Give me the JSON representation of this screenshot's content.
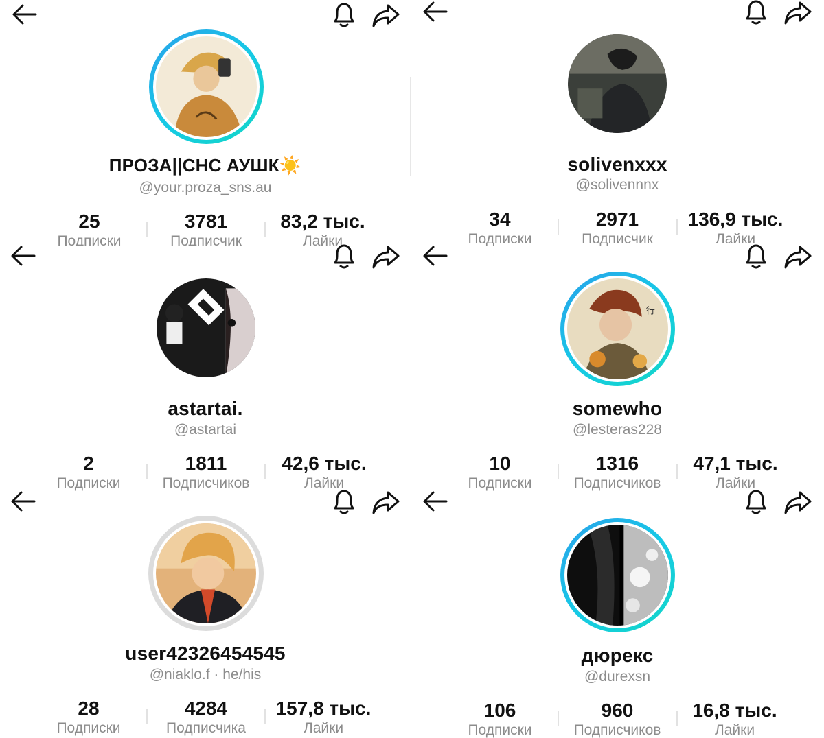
{
  "profiles": [
    {
      "display_name": "ПРОЗА||СНС АУШК☀️",
      "handle": "@your.proza_sns.au",
      "stats": [
        {
          "value": "25",
          "label": "Подписки"
        },
        {
          "value": "3781",
          "label": "Подписчик"
        },
        {
          "value": "83,2 тыс.",
          "label": "Лайки"
        }
      ],
      "ring": "gradient",
      "icons": {
        "back": "arrow-left-icon",
        "notify": "bell-icon",
        "share": "share-arrow-icon"
      }
    },
    {
      "display_name": "solivenxxx",
      "handle": "@solivennnx",
      "stats": [
        {
          "value": "34",
          "label": "Подписки"
        },
        {
          "value": "2971",
          "label": "Подписчик"
        },
        {
          "value": "136,9 тыс.",
          "label": "Лайки"
        }
      ],
      "ring": "none",
      "icons": {
        "back": "arrow-left-icon",
        "notify": "bell-icon",
        "share": "share-arrow-icon"
      }
    },
    {
      "display_name": "astartai.",
      "handle": "@astartai",
      "stats": [
        {
          "value": "2",
          "label": "Подписки"
        },
        {
          "value": "1811",
          "label": "Подписчиков"
        },
        {
          "value": "42,6 тыс.",
          "label": "Лайки"
        }
      ],
      "ring": "none",
      "icons": {
        "back": "arrow-left-icon",
        "notify": "bell-icon",
        "share": "share-arrow-icon"
      }
    },
    {
      "display_name": "somewho",
      "handle": "@lesteras228",
      "stats": [
        {
          "value": "10",
          "label": "Подписки"
        },
        {
          "value": "1316",
          "label": "Подписчиков"
        },
        {
          "value": "47,1 тыс.",
          "label": "Лайки"
        }
      ],
      "ring": "gradient",
      "icons": {
        "back": "arrow-left-icon",
        "notify": "bell-icon",
        "share": "share-arrow-icon"
      }
    },
    {
      "display_name": "user42326454545",
      "handle": "@niaklo.f · he/his",
      "stats": [
        {
          "value": "28",
          "label": "Подписки"
        },
        {
          "value": "4284",
          "label": "Подписчика"
        },
        {
          "value": "157,8 тыс.",
          "label": "Лайки"
        }
      ],
      "ring": "gray",
      "icons": {
        "back": "arrow-left-icon",
        "notify": "bell-icon",
        "share": "share-arrow-icon"
      }
    },
    {
      "display_name": "дюрекс",
      "handle": "@durexsn",
      "stats": [
        {
          "value": "106",
          "label": "Подписки"
        },
        {
          "value": "960",
          "label": "Подписчиков"
        },
        {
          "value": "16,8 тыс.",
          "label": "Лайки"
        }
      ],
      "ring": "gradient",
      "icons": {
        "back": "arrow-left-icon",
        "notify": "bell-icon",
        "share": "share-arrow-icon"
      }
    }
  ],
  "colors": {
    "ring_gradient": [
      "#2aa0ea",
      "#12d7c6"
    ],
    "ring_gray": "#dcdcdc",
    "secondary_text": "#8c8c8c",
    "primary_text": "#111111"
  }
}
